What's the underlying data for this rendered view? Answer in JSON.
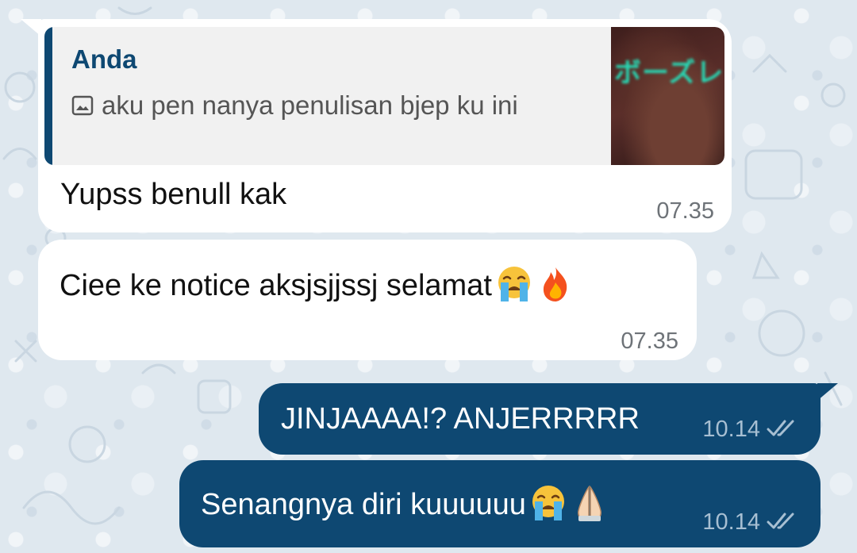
{
  "messages": [
    {
      "direction": "incoming",
      "reply": {
        "sender": "Anda",
        "media_icon": "photo-icon",
        "text": "aku pen nanya penulisan bjep ku ini",
        "thumbnail_text": "ボーズレ"
      },
      "text": "Yupss benull kak",
      "time": "07.35"
    },
    {
      "direction": "incoming",
      "text": "Ciee ke notice aksjsjjssj selamat",
      "emojis": [
        "loudly-crying-face-icon",
        "fire-icon"
      ],
      "time": "07.35"
    },
    {
      "direction": "outgoing",
      "text": "JINJAAAA!? ANJERRRRR",
      "time": "10.14",
      "status_icon": "double-check-icon"
    },
    {
      "direction": "outgoing",
      "text": "Senangnya diri kuuuuuu",
      "emojis": [
        "loudly-crying-face-icon",
        "folded-hands-icon"
      ],
      "time": "10.14",
      "status_icon": "double-check-icon"
    }
  ],
  "colors": {
    "outgoing_bubble": "#0e4872",
    "incoming_bubble": "#ffffff",
    "reply_accent": "#0e4872",
    "wallpaper": "#dfe8ef"
  }
}
